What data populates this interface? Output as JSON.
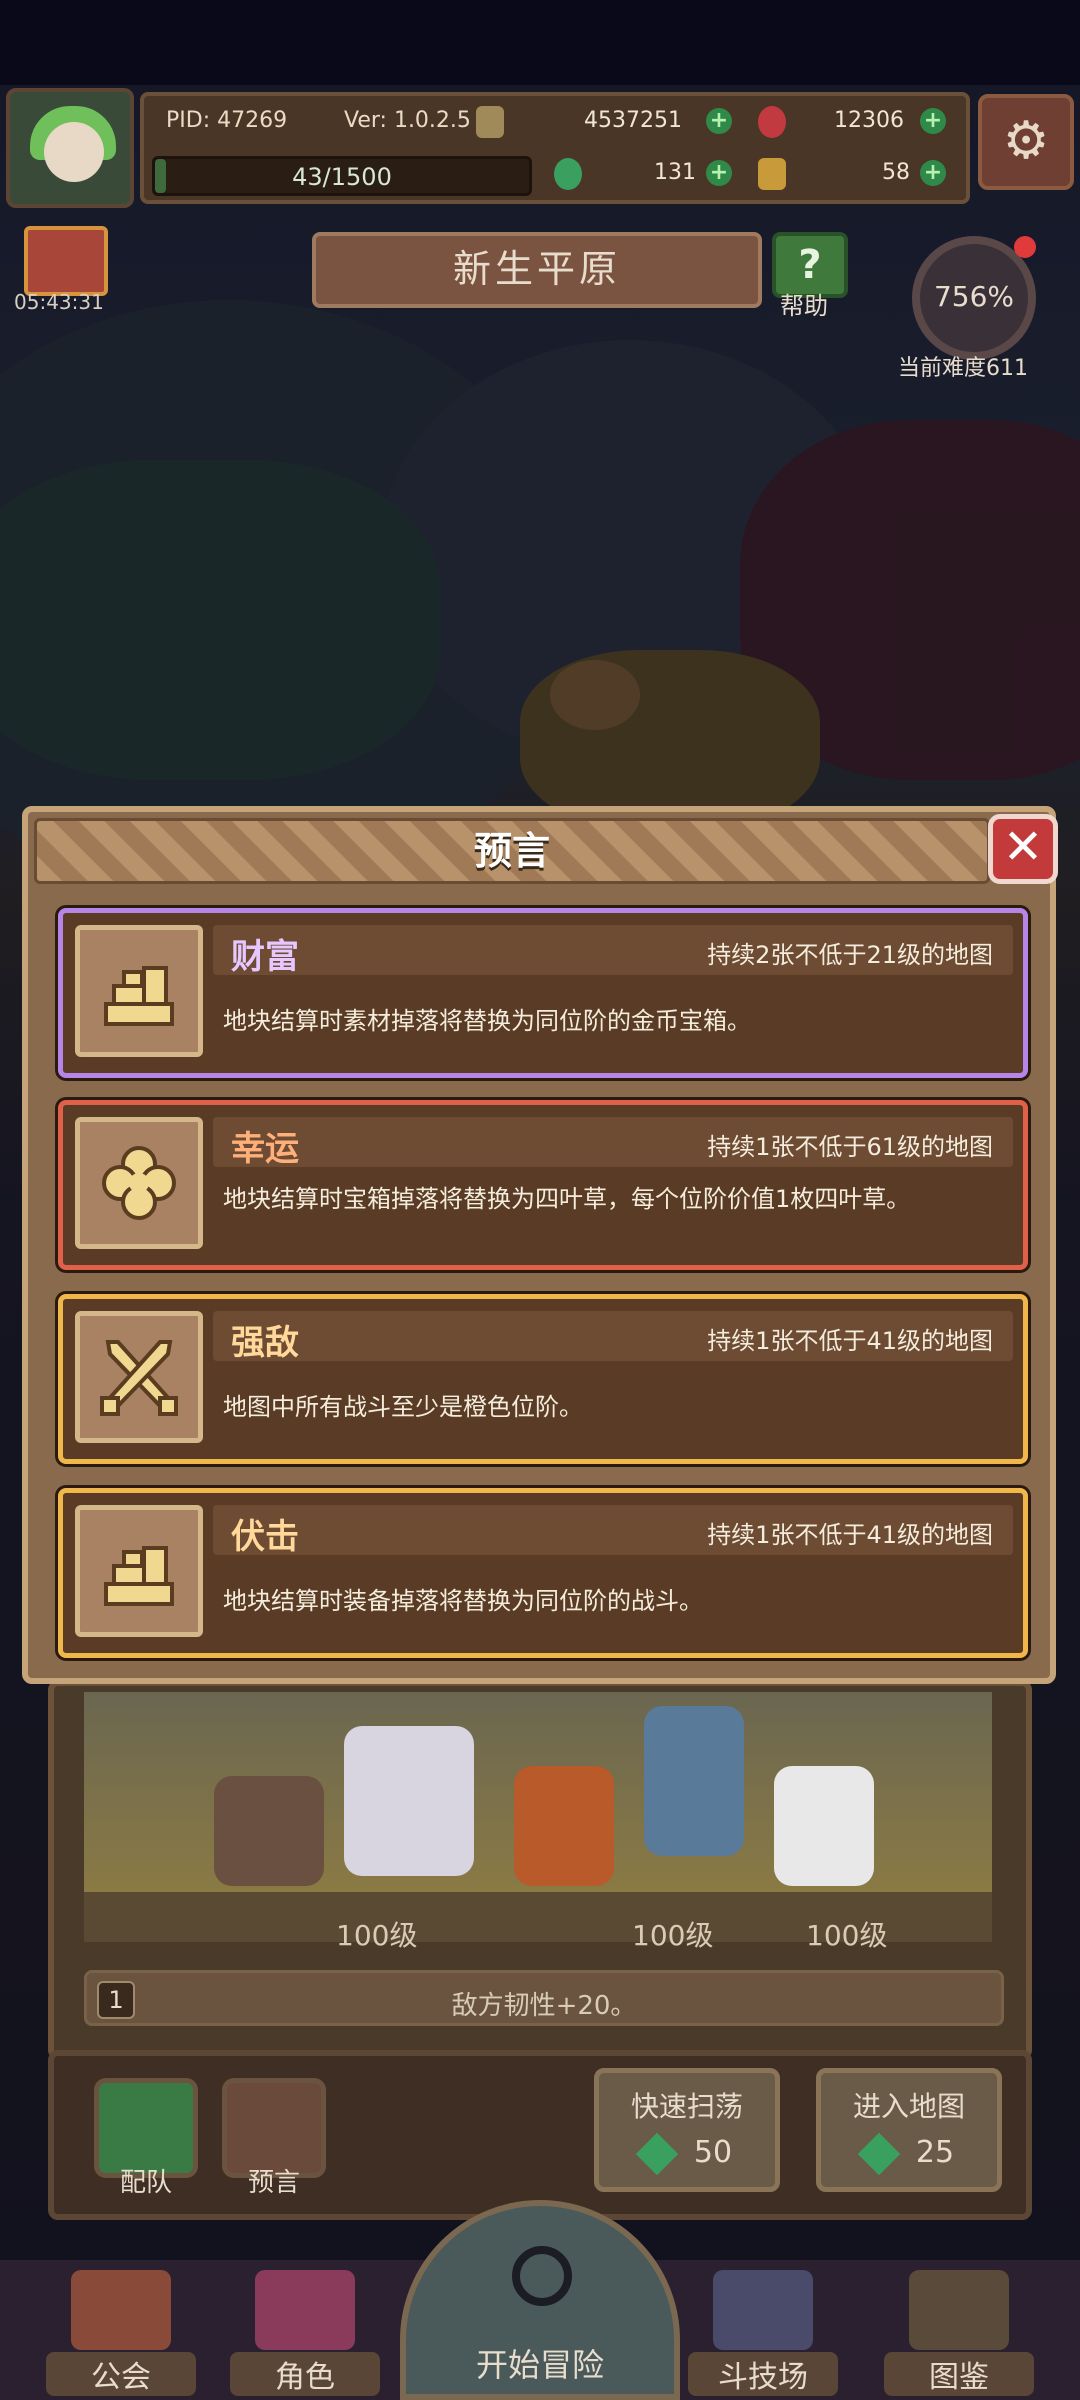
{
  "hud": {
    "pid": "PID: 47269",
    "version": "Ver: 1.0.2.5",
    "gold": "4537251",
    "gems_red": "12306",
    "stamina": "43/1500",
    "stamina_ratio": 0.029,
    "clover": "131",
    "material": "58"
  },
  "gift_timer": "05:43:31",
  "map_title": "新生平原",
  "help": {
    "icon": "?",
    "label": "帮助"
  },
  "difficulty": {
    "percent": "756%",
    "label": "当前难度611"
  },
  "modal": {
    "title": "预言",
    "close_icon": "✕",
    "cards": [
      {
        "name": "财富",
        "duration": "持续2张不低于21级的地图",
        "desc": "地块结算时素材掉落将替换为同位阶的金币宝箱。",
        "frame": "#b586e6",
        "name_color": "#e6c8ff",
        "icon": "gold-stack-icon"
      },
      {
        "name": "幸运",
        "duration": "持续1张不低于61级的地图",
        "desc": "地块结算时宝箱掉落将替换为四叶草，每个位阶价值1枚四叶草。",
        "frame": "#e0604a",
        "name_color": "#ffb07a",
        "icon": "clover-icon"
      },
      {
        "name": "强敌",
        "duration": "持续1张不低于41级的地图",
        "desc": "地图中所有战斗至少是橙色位阶。",
        "frame": "#f0b84a",
        "name_color": "#ffd89a",
        "icon": "crossed-swords-icon"
      },
      {
        "name": "伏击",
        "duration": "持续1张不低于41级的地图",
        "desc": "地块结算时装备掉落将替换为同位阶的战斗。",
        "frame": "#f0b84a",
        "name_color": "#ffd89a",
        "icon": "gold-stack-icon"
      }
    ]
  },
  "stage": {
    "levels": [
      "100级",
      "100级",
      "100级"
    ],
    "effect_num": "1",
    "effect_text": "敌方韧性+20。"
  },
  "actions": {
    "team": "配队",
    "prophecy": "预言",
    "sweep": {
      "label": "快速扫荡",
      "cost": "50"
    },
    "enter": {
      "label": "进入地图",
      "cost": "25"
    }
  },
  "nav": {
    "guild": "公会",
    "character": "角色",
    "adventure": "开始冒险",
    "arena": "斗技场",
    "codex": "图鉴"
  }
}
